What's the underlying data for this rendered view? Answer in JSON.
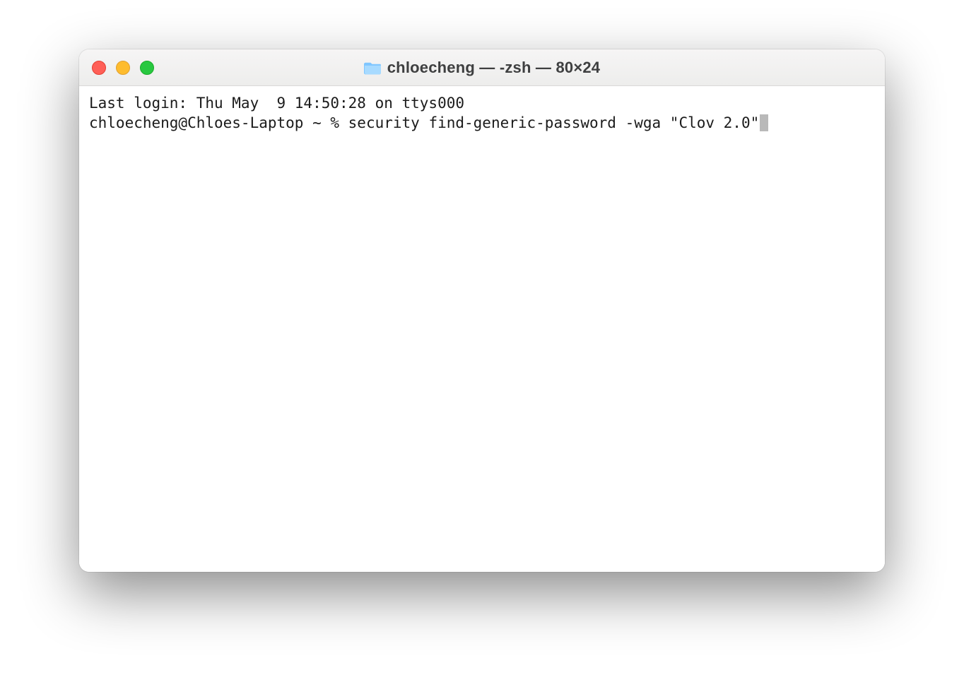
{
  "window": {
    "title": "chloecheng — -zsh — 80×24"
  },
  "terminal": {
    "last_login_line": "Last login: Thu May  9 14:50:28 on ttys000",
    "prompt": "chloecheng@Chloes-Laptop ~ % ",
    "command": "security find-generic-password -wga \"Clov 2.0\""
  }
}
